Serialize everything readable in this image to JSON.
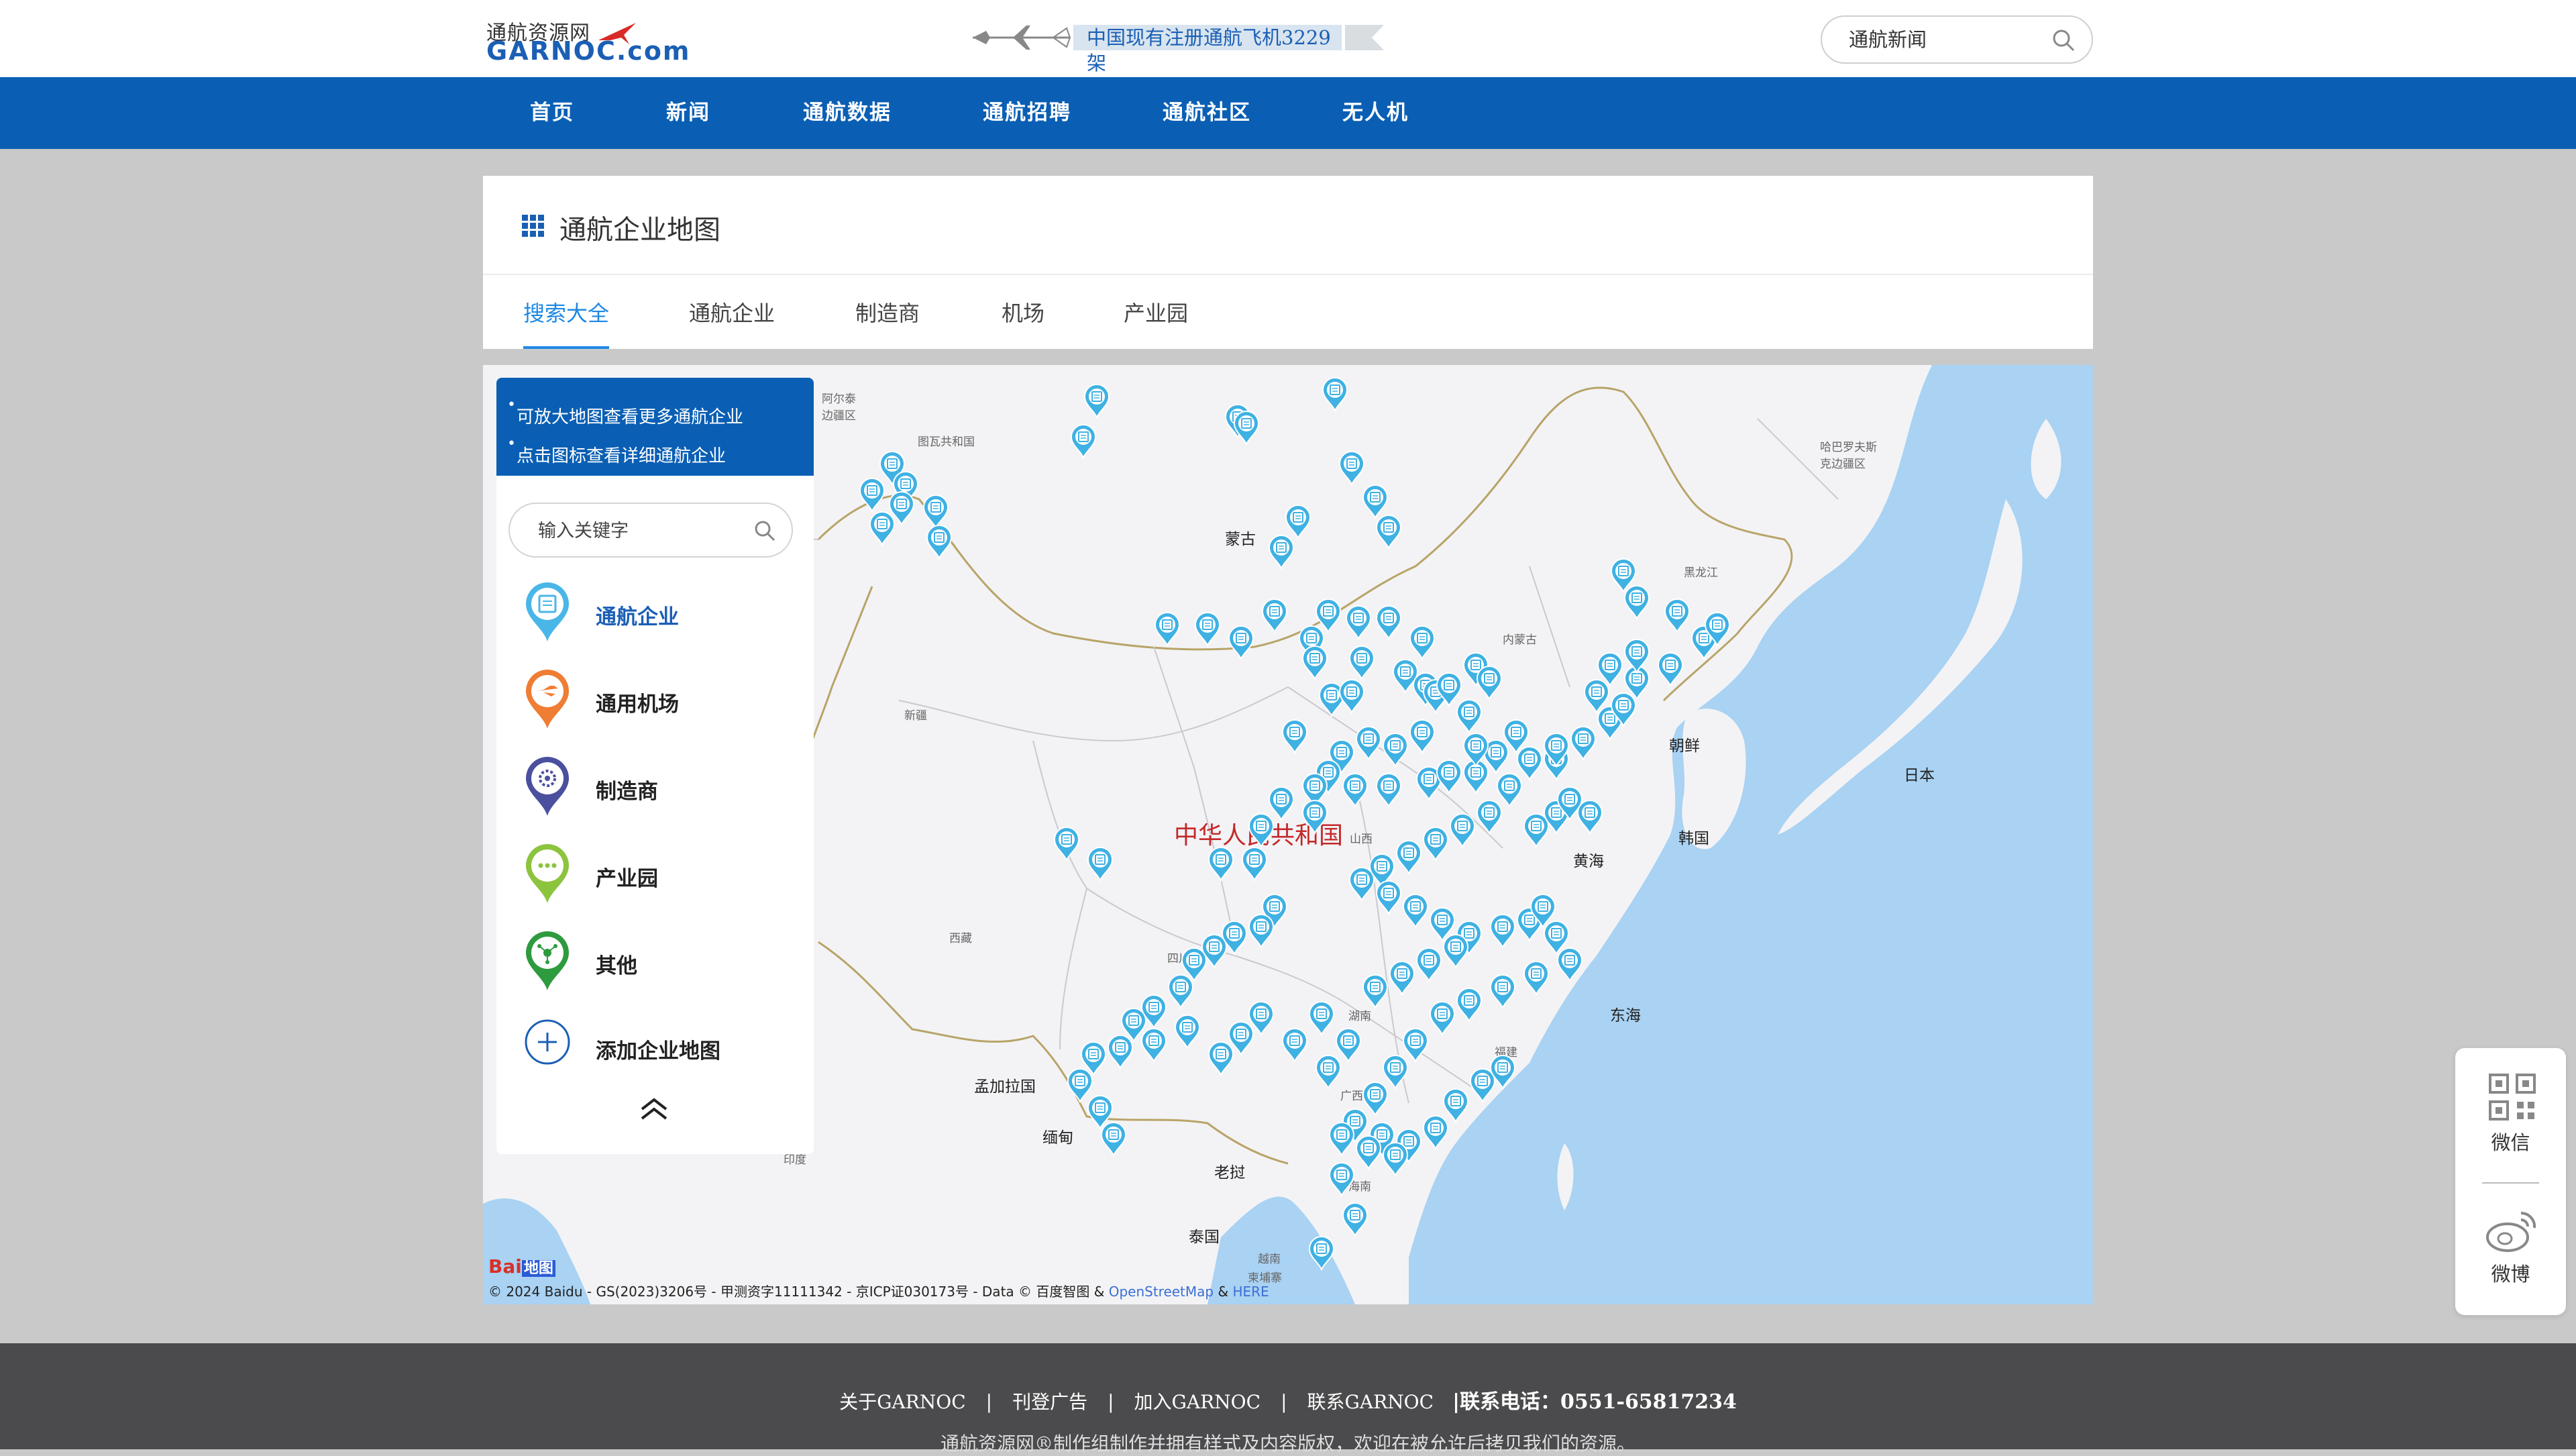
{
  "header": {
    "logo_cn": "通航资源网",
    "logo_en": "GARNOC.com",
    "banner_text": "中国现有注册通航飞机3229架",
    "search_placeholder": "通航新闻"
  },
  "nav": {
    "items": [
      "首页",
      "新闻",
      "通航数据",
      "通航招聘",
      "通航社区",
      "无人机"
    ]
  },
  "panel": {
    "title": "通航企业地图",
    "tabs": [
      "搜索大全",
      "通航企业",
      "制造商",
      "机场",
      "产业园"
    ],
    "active_tab": "搜索大全"
  },
  "side": {
    "tips": [
      "可放大地图查看更多通航企业",
      "点击图标查看详细通航企业"
    ],
    "search_placeholder": "输入关键字",
    "categories": [
      {
        "label": "通航企业",
        "icon": "aviation-company-pin-icon",
        "color": "#4ab6e8",
        "active": true
      },
      {
        "label": "通用机场",
        "icon": "airport-pin-icon",
        "color": "#ef7d33",
        "active": false
      },
      {
        "label": "制造商",
        "icon": "manufacturer-pin-icon",
        "color": "#4a4f9e",
        "active": false
      },
      {
        "label": "产业园",
        "icon": "industrial-park-pin-icon",
        "color": "#8cc43e",
        "active": false
      },
      {
        "label": "其他",
        "icon": "other-pin-icon",
        "color": "#2e9b3e",
        "active": false
      },
      {
        "label": "添加企业地图",
        "icon": "add-circle-icon",
        "color": "#1b5fb5",
        "active": false
      }
    ]
  },
  "map": {
    "labels": {
      "mongolia": "蒙古",
      "china": "中华人民共和国",
      "north_korea": "朝鲜",
      "south_korea": "韩国",
      "japan": "日本",
      "bangladesh": "孟加拉国",
      "myanmar": "缅甸",
      "laos": "老挝",
      "thailand": "泰国",
      "india": "印度",
      "heilongjiang": "黑龙江",
      "inner_mongolia": "内蒙古",
      "xinjiang": "新疆",
      "tibet": "西藏",
      "sichuan": "四川",
      "shanxi": "山西",
      "hunan": "湖南",
      "fujian": "福建",
      "guangxi": "广西",
      "hainan": "海南",
      "east_sea": "东海",
      "yellow_sea": "黄海",
      "vietnam": "越南",
      "cambodia": "柬埔寨",
      "altay": "阿尔泰边疆区",
      "tuva": "图瓦共和国",
      "khabarovsk": "哈巴罗夫斯克边疆区"
    },
    "copyright": "© 2024 Baidu - GS(2023)3206号 - 甲测资字11111342 - 京ICP证030173号 - Data © 百度智图 &",
    "copyright_link1": "OpenStreetMap",
    "copyright_amp": "&",
    "copyright_link2": "HERE",
    "baidu_logo": "Bai",
    "baidu_logo_map": "地图",
    "water_color": "#a9d2f3",
    "pin_color": "#3fb1e3"
  },
  "share": {
    "wechat": "微信",
    "weibo": "微博"
  },
  "footer": {
    "links": [
      "关于GARNOC",
      "刊登广告",
      "加入GARNOC",
      "联系GARNOC"
    ],
    "phone": "|联系电话：0551-65817234",
    "copyright": "通航资源网®制作组制作并拥有样式及内容版权，欢迎在被允许后拷贝我们的资源。"
  }
}
